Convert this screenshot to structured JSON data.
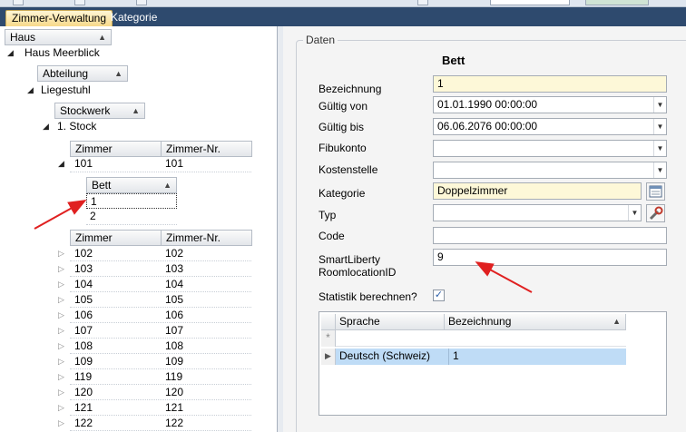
{
  "tabs": [
    {
      "label": "Zimmer-Verwaltung",
      "active": true
    },
    {
      "label": "Kategorie",
      "active": false
    }
  ],
  "tree": {
    "haus": {
      "header": "Haus",
      "value": "Haus Meerblick"
    },
    "abteilung": {
      "header": "Abteilung",
      "value": "Liegestuhl"
    },
    "stockwerk": {
      "header": "Stockwerk",
      "value": "1. Stock"
    },
    "zimmer_top": {
      "headers": [
        "Zimmer",
        "Zimmer-Nr."
      ],
      "row": [
        "101",
        "101"
      ]
    },
    "bett": {
      "header": "Bett",
      "rows": [
        "1",
        "2"
      ]
    },
    "zimmer_list": {
      "headers": [
        "Zimmer",
        "Zimmer-Nr."
      ],
      "rows": [
        [
          "102",
          "102"
        ],
        [
          "103",
          "103"
        ],
        [
          "104",
          "104"
        ],
        [
          "105",
          "105"
        ],
        [
          "106",
          "106"
        ],
        [
          "107",
          "107"
        ],
        [
          "108",
          "108"
        ],
        [
          "109",
          "109"
        ],
        [
          "119",
          "119"
        ],
        [
          "120",
          "120"
        ],
        [
          "121",
          "121"
        ],
        [
          "122",
          "122"
        ]
      ]
    }
  },
  "details": {
    "group_title": "Daten",
    "form_title": "Bett",
    "fields": {
      "bezeichnung": {
        "label": "Bezeichnung",
        "value": "1"
      },
      "gueltig_von": {
        "label": "Gültig von",
        "value": "01.01.1990 00:00:00"
      },
      "gueltig_bis": {
        "label": "Gültig bis",
        "value": "06.06.2076 00:00:00"
      },
      "fibukonto": {
        "label": "Fibukonto",
        "value": ""
      },
      "kostenstelle": {
        "label": "Kostenstelle",
        "value": ""
      },
      "kategorie": {
        "label": "Kategorie",
        "value": "Doppelzimmer"
      },
      "typ": {
        "label": "Typ",
        "value": ""
      },
      "code": {
        "label": "Code",
        "value": ""
      },
      "smartliberty": {
        "label_line1": "SmartLiberty",
        "label_line2": "RoomlocationID",
        "value": "9"
      },
      "statistik": {
        "label": "Statistik berechnen?",
        "checked": true
      }
    },
    "grid": {
      "headers": [
        "Sprache",
        "Bezeichnung"
      ],
      "new_row_marker": "*",
      "rows": [
        [
          "Deutsch (Schweiz)",
          "1"
        ]
      ]
    }
  },
  "icons": {
    "expanded": "tree-expanded-icon",
    "collapsed": "tree-collapsed-icon",
    "sort": "sort-ascending-icon",
    "dropdown": "chevron-down-icon",
    "calendar": "calendar-icon",
    "wrench": "wrench-icon",
    "row_pointer": "row-pointer-icon"
  },
  "colors": {
    "tab_bar": "#2e4a6e",
    "active_tab": "#f7d98a",
    "required_field": "#fdf8d8",
    "selected_row": "#bfdcf6",
    "annotation_arrow": "#e02020"
  }
}
